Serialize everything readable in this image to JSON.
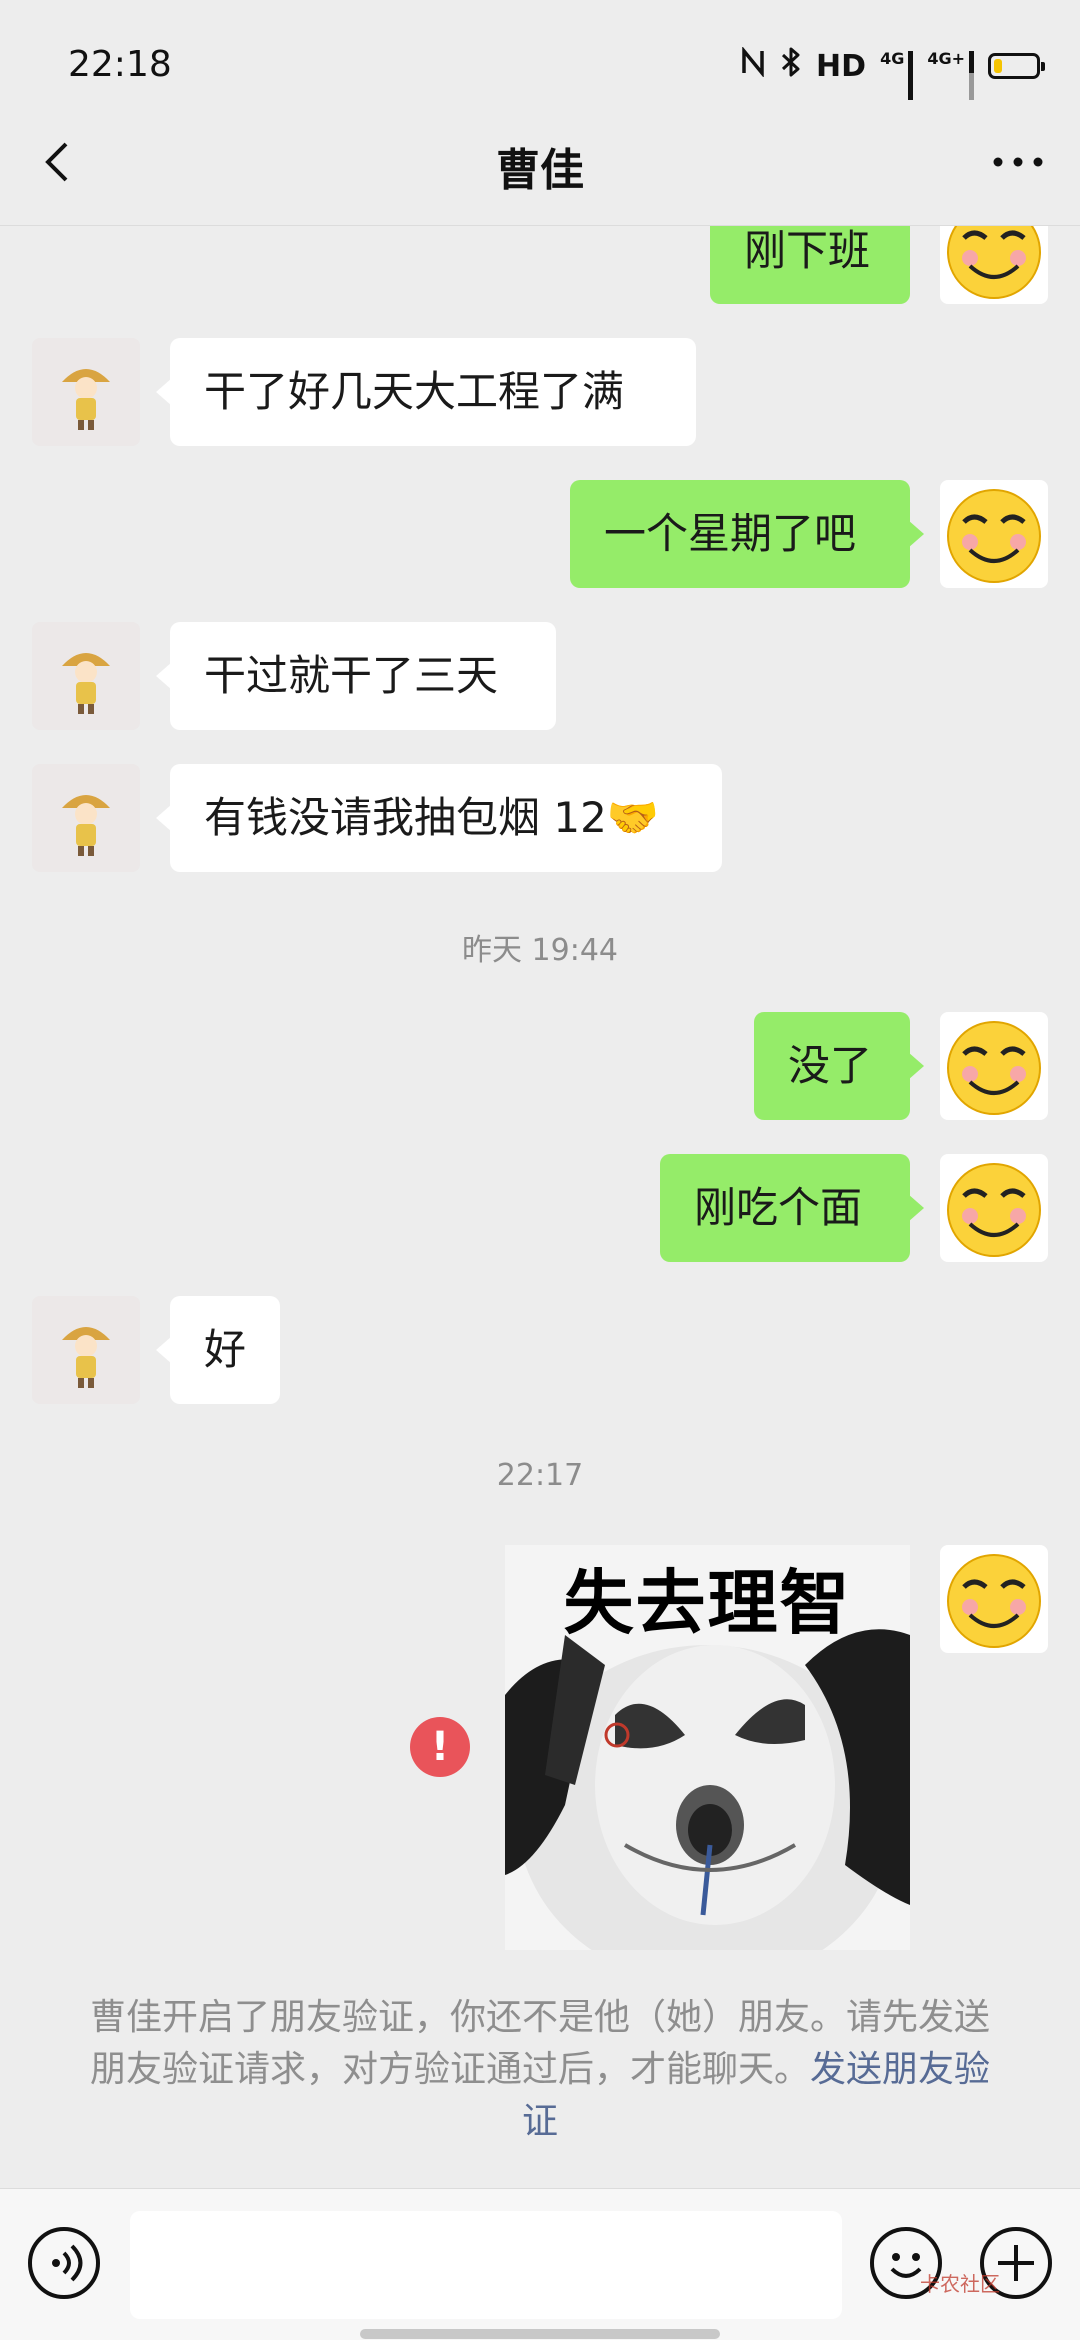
{
  "status_bar": {
    "time": "22:18",
    "icons": [
      "nfc-icon",
      "bluetooth-icon",
      "hd-icon",
      "4g-signal-icon",
      "4g-signal-icon",
      "battery-icon"
    ],
    "hd_label": "HD",
    "net1": "4G",
    "net2": "4G+",
    "battery_level": 0.2
  },
  "header": {
    "title": "曹佳",
    "back_icon": "chevron-left-icon",
    "more_icon": "more-dots-icon"
  },
  "messages": [
    {
      "sender": "me",
      "text": "刚下班"
    },
    {
      "sender": "other",
      "text": "干了好几天大工程了满"
    },
    {
      "sender": "me",
      "text": "一个星期了吧"
    },
    {
      "sender": "other",
      "text": "干过就干了三天"
    },
    {
      "sender": "other",
      "text": "有钱没请我抽包烟 12🤝"
    },
    {
      "sender": "me",
      "text": "没了"
    },
    {
      "sender": "me",
      "text": "刚吃个面"
    },
    {
      "sender": "other",
      "text": "好"
    }
  ],
  "timestamps": [
    "昨天 19:44",
    "22:17"
  ],
  "sticker": {
    "caption": "失去理智",
    "status": "failed"
  },
  "notice": {
    "text": "曹佳开启了朋友验证，你还不是他（她）朋友。请先发送朋友验证请求，对方验证通过后，才能聊天。",
    "link": "发送朋友验证"
  },
  "input_bar": {
    "voice_icon": "voice-icon",
    "emoji_icon": "emoji-icon",
    "plus_icon": "plus-icon",
    "input_value": ""
  },
  "watermark": "卡农社区",
  "colors": {
    "background": "#ededed",
    "my_bubble": "#95ec69",
    "other_bubble": "#ffffff",
    "error": "#e9545a",
    "link": "#576b95"
  }
}
